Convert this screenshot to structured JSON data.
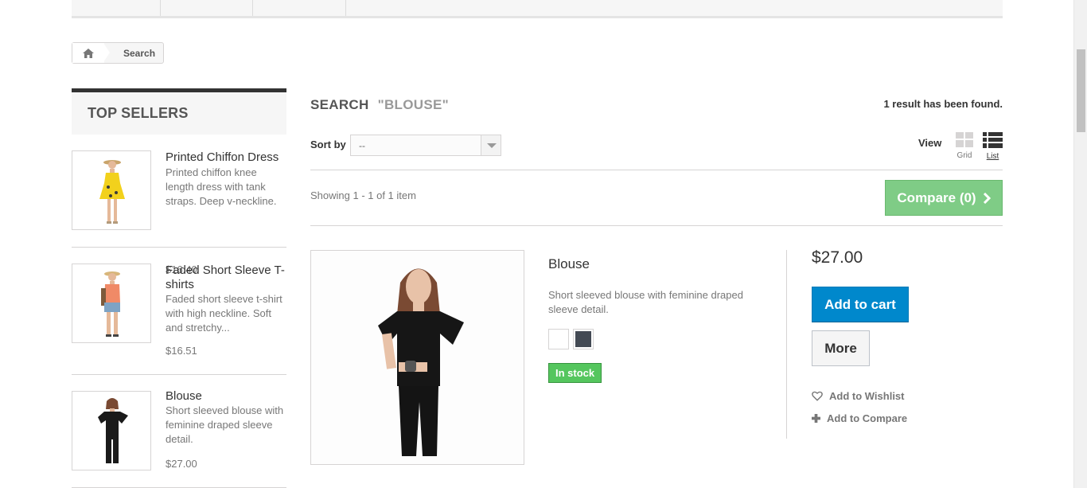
{
  "breadcrumb": {
    "home_icon": "home-icon",
    "current": "Search"
  },
  "sidebar": {
    "title": "Top sellers",
    "items": [
      {
        "name": "Printed Chiffon Dress",
        "description": "Printed chiffon knee length dress with tank straps. Deep v-neckline.",
        "price": "$16.40"
      },
      {
        "name": "Faded Short Sleeve T-shirts",
        "description": "Faded short sleeve t-shirt with high neckline. Soft and stretchy...",
        "price": "$16.51"
      },
      {
        "name": "Blouse",
        "description": "Short sleeved blouse with feminine draped sleeve detail.",
        "price": "$27.00"
      }
    ]
  },
  "main": {
    "title": "Search",
    "query": "\"BLOUSE\"",
    "result_count": "1 result has been found.",
    "sort_label": "Sort by",
    "sort_value": "--",
    "view_label": "View",
    "view_grid": "Grid",
    "view_list": "List",
    "showing": "Showing 1 - 1 of 1 item",
    "compare_label": "Compare (0)"
  },
  "product": {
    "name": "Blouse",
    "description": "Short sleeved blouse with feminine draped sleeve detail.",
    "colors": [
      "#ffffff",
      "#434a54"
    ],
    "stock": "In stock",
    "price": "$27.00",
    "add_to_cart": "Add to cart",
    "more": "More",
    "wishlist": "Add to Wishlist",
    "compare": "Add to Compare"
  }
}
